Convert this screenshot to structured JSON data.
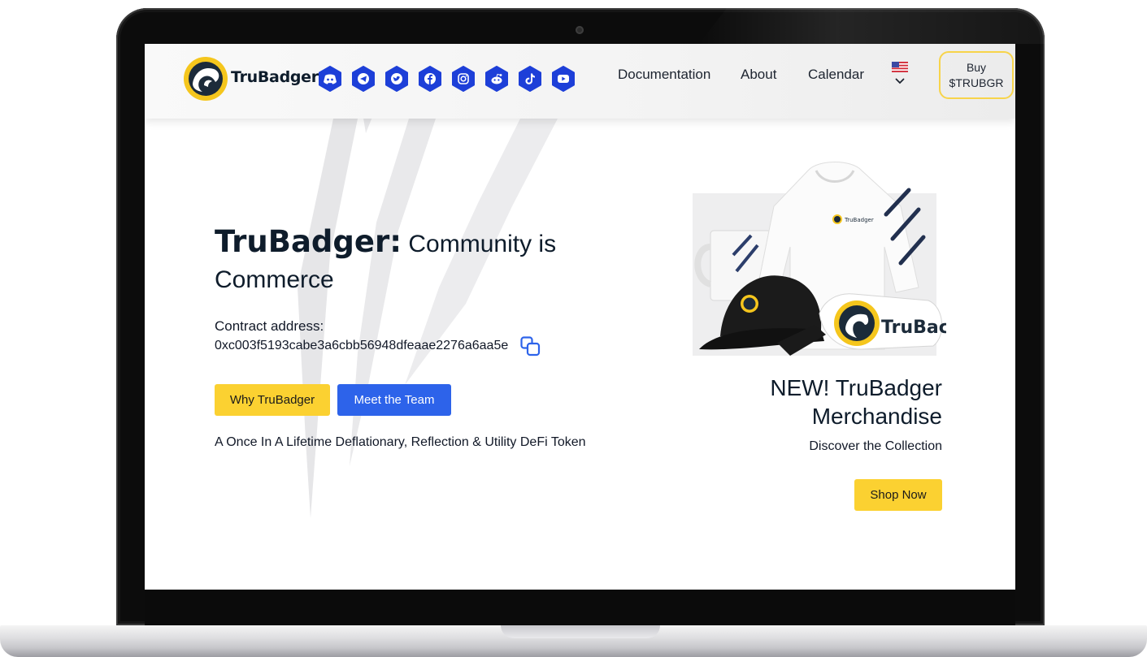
{
  "header": {
    "brand_name": "TruBadger",
    "social_icons": [
      "discord-icon",
      "telegram-icon",
      "twitter-icon",
      "facebook-icon",
      "instagram-icon",
      "reddit-icon",
      "tiktok-icon",
      "youtube-icon"
    ],
    "nav": {
      "documentation": "Documentation",
      "about": "About",
      "calendar": "Calendar"
    },
    "language_flag": "us-flag-icon",
    "buy_button": {
      "line1": "Buy",
      "line2": "$TRUBGR"
    }
  },
  "hero": {
    "title_strong": "TruBadger:",
    "title_rest": " Community is Commerce",
    "contract_label": "Contract address:",
    "contract_address": "0xc003f5193cabe3a6cbb56948dfeaae2276a6aa5e",
    "why_button": "Why TruBadger",
    "team_button": "Meet the Team",
    "tagline": "A Once In A Lifetime Deflationary, Reflection & Utility DeFi Token"
  },
  "merch": {
    "image_text": "TruBac",
    "title": "NEW! TruBadger Merchandise",
    "subtitle": "Discover the Collection",
    "shop_button": "Shop Now"
  },
  "colors": {
    "accent_yellow": "#fbd131",
    "accent_blue": "#2d63ea",
    "social_blue": "#1d3fd8",
    "navy": "#0e1c2b"
  }
}
